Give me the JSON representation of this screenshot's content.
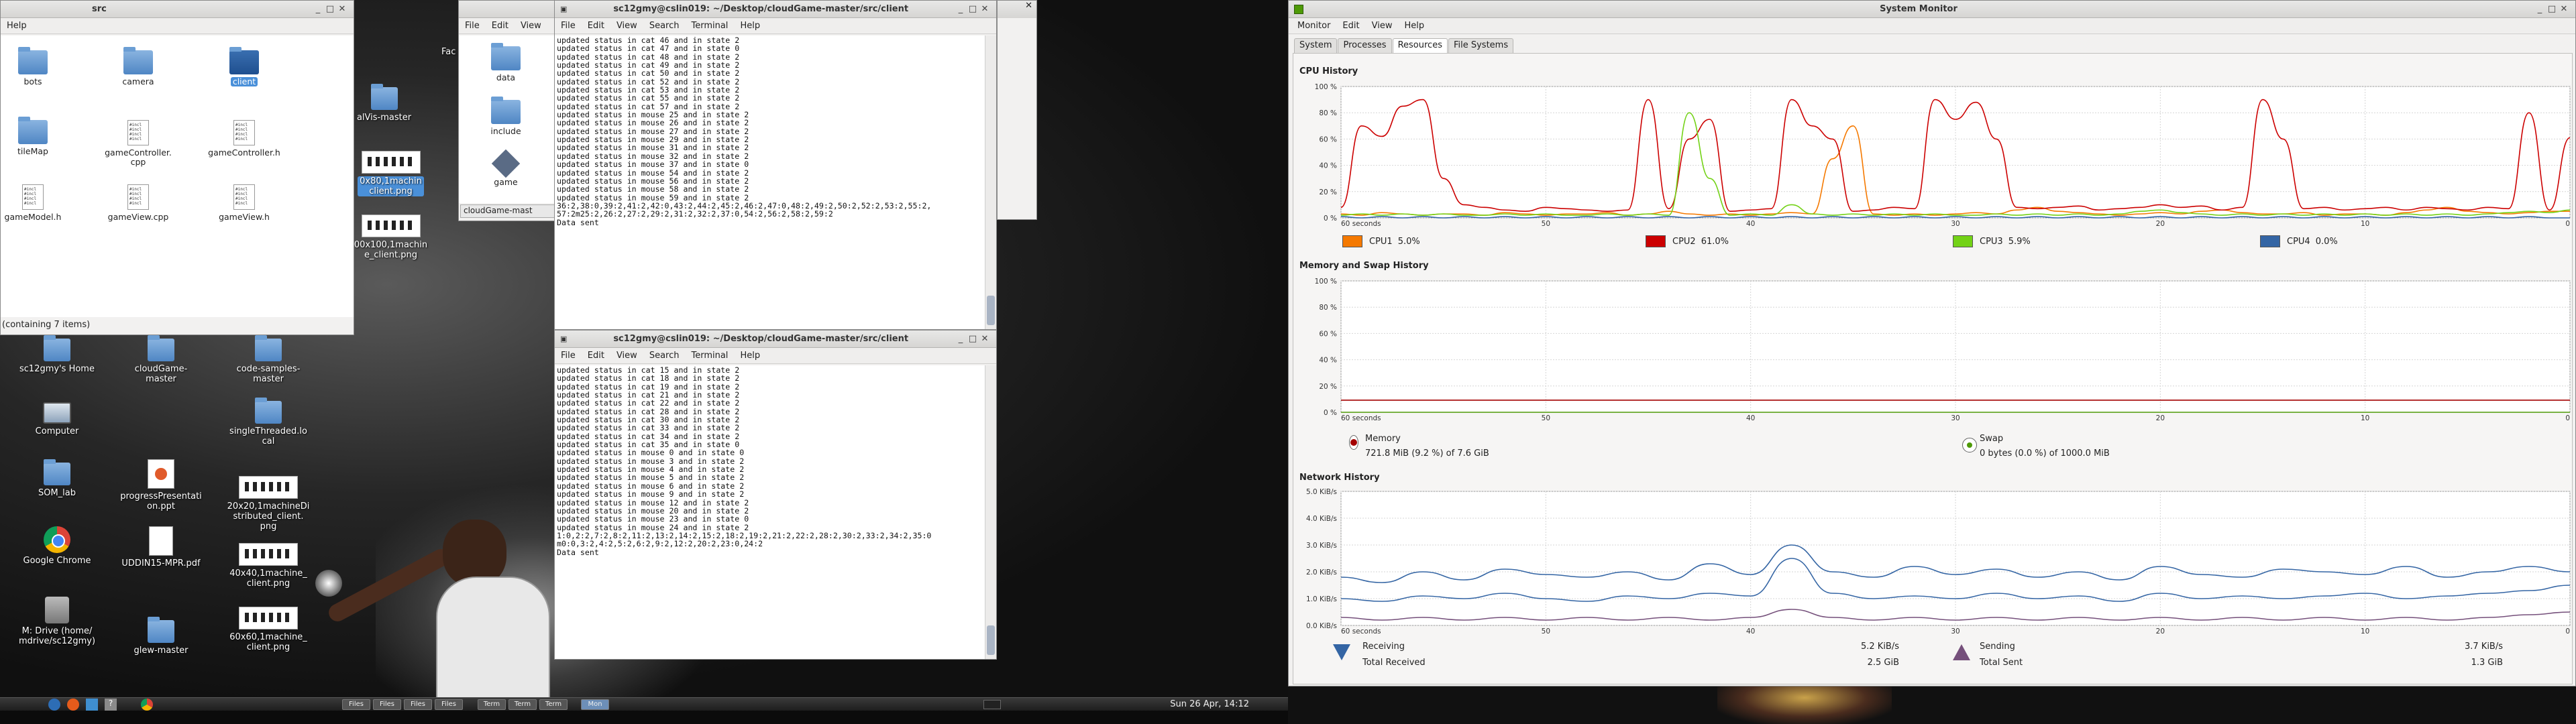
{
  "file_manager": {
    "title": "src",
    "menu_help": "Help",
    "status": "(containing 7 items)",
    "items": [
      {
        "label": "bots",
        "kind": "folder"
      },
      {
        "label": "camera",
        "kind": "folder"
      },
      {
        "label": "client",
        "kind": "folder",
        "selected": true
      },
      {
        "label": "tileMap",
        "kind": "folder"
      },
      {
        "label": "gameController.\ncpp",
        "kind": "file"
      },
      {
        "label": "gameController.h",
        "kind": "file"
      },
      {
        "label": "gameModel.h",
        "kind": "file"
      },
      {
        "label": "gameView.cpp",
        "kind": "file"
      },
      {
        "label": "gameView.h",
        "kind": "file"
      }
    ],
    "file_icon_text": "#incl\n#incl\n#incl\n#incl"
  },
  "file_manager_2": {
    "menu": [
      "File",
      "Edit",
      "View",
      "F"
    ],
    "items": [
      {
        "label": "data"
      },
      {
        "label": "include"
      },
      {
        "label": "game"
      }
    ],
    "path_button": "cloudGame-mast"
  },
  "desktop_partial": {
    "fac_label": "Fac",
    "alvis_label": "alVis-master",
    "img1_label": "0x80,1machin\nclient.png",
    "img2_label": "00x100,1machin\ne_client.png"
  },
  "terminal_top": {
    "title": "sc12gmy@cslin019: ~/Desktop/cloudGame-master/src/client",
    "menu": [
      "File",
      "Edit",
      "View",
      "Search",
      "Terminal",
      "Help"
    ],
    "lines": [
      "updated status in cat 46 and in state 2",
      "updated status in cat 47 and in state 0",
      "updated status in cat 48 and in state 2",
      "updated status in cat 49 and in state 2",
      "updated status in cat 50 and in state 2",
      "updated status in cat 52 and in state 2",
      "updated status in cat 53 and in state 2",
      "updated status in cat 55 and in state 2",
      "updated status in cat 57 and in state 2",
      "updated status in mouse 25 and in state 2",
      "updated status in mouse 26 and in state 2",
      "updated status in mouse 27 and in state 2",
      "updated status in mouse 29 and in state 2",
      "updated status in mouse 31 and in state 2",
      "updated status in mouse 32 and in state 2",
      "updated status in mouse 37 and in state 0",
      "updated status in mouse 54 and in state 2",
      "updated status in mouse 56 and in state 2",
      "updated status in mouse 58 and in state 2",
      "updated status in mouse 59 and in state 2",
      "36:2,38:0,39:2,41:2,42:0,43:2,44:2,45:2,46:2,47:0,48:2,49:2,50:2,52:2,53:2,55:2,",
      "57:2m25:2,26:2,27:2,29:2,31:2,32:2,37:0,54:2,56:2,58:2,59:2",
      "Data sent",
      ""
    ]
  },
  "terminal_bottom": {
    "title": "sc12gmy@cslin019: ~/Desktop/cloudGame-master/src/client",
    "menu": [
      "File",
      "Edit",
      "View",
      "Search",
      "Terminal",
      "Help"
    ],
    "lines": [
      "updated status in cat 15 and in state 2",
      "updated status in cat 18 and in state 2",
      "updated status in cat 19 and in state 2",
      "updated status in cat 21 and in state 2",
      "updated status in cat 22 and in state 2",
      "updated status in cat 28 and in state 2",
      "updated status in cat 30 and in state 2",
      "updated status in cat 33 and in state 2",
      "updated status in cat 34 and in state 2",
      "updated status in cat 35 and in state 0",
      "updated status in mouse 0 and in state 0",
      "updated status in mouse 3 and in state 2",
      "updated status in mouse 4 and in state 2",
      "updated status in mouse 5 and in state 2",
      "updated status in mouse 6 and in state 2",
      "updated status in mouse 9 and in state 2",
      "updated status in mouse 12 and in state 2",
      "updated status in mouse 20 and in state 2",
      "updated status in mouse 23 and in state 0",
      "updated status in mouse 24 and in state 2",
      "1:0,2:2,7:2,8:2,11:2,13:2,14:2,15:2,18:2,19:2,21:2,22:2,28:2,30:2,33:2,34:2,35:0",
      "m0:0,3:2,4:2,5:2,6:2,9:2,12:2,20:2,23:0,24:2",
      "Data sent",
      ""
    ]
  },
  "desktop_icons": [
    {
      "label": "sc12gmy's Home",
      "kind": "folder"
    },
    {
      "label": "cloudGame-\nmaster",
      "kind": "folder"
    },
    {
      "label": "code-samples-\nmaster",
      "kind": "folder"
    },
    {
      "label": "Computer",
      "kind": "computer"
    },
    {
      "label": "singleThreaded.lo\ncal",
      "kind": "folder"
    },
    {
      "label": "SOM_lab",
      "kind": "folder"
    },
    {
      "label": "progressPresentati\non.ppt",
      "kind": "ppt"
    },
    {
      "label": "20x20,1machineDi\nstributed_client.\npng",
      "kind": "image"
    },
    {
      "label": "Google Chrome",
      "kind": "chrome"
    },
    {
      "label": "UDDIN15-MPR.pdf",
      "kind": "doc"
    },
    {
      "label": "40x40,1machine_\nclient.png",
      "kind": "image"
    },
    {
      "label": "M: Drive (home/\nmdrive/sc12gmy)",
      "kind": "drive"
    },
    {
      "label": "glew-master",
      "kind": "folder"
    },
    {
      "label": "60x60,1machine_\nclient.png",
      "kind": "image"
    }
  ],
  "taskbar": {
    "clock": "Sun 26 Apr, 14:12",
    "buttons": [
      "Files",
      "Files",
      "Files",
      "Files",
      "Term",
      "Term",
      "Term",
      "Mon"
    ]
  },
  "system_monitor": {
    "title": "System Monitor",
    "menu": [
      "Monitor",
      "Edit",
      "View",
      "Help"
    ],
    "tabs": [
      "System",
      "Processes",
      "Resources",
      "File Systems"
    ],
    "active_tab": "Resources",
    "cpu_title": "CPU History",
    "mem_title": "Memory and Swap History",
    "net_title": "Network History",
    "cpu_legend": [
      {
        "name": "CPU1",
        "value": "5.0%",
        "color": "#f57900"
      },
      {
        "name": "CPU2",
        "value": "61.0%",
        "color": "#cc0000"
      },
      {
        "name": "CPU3",
        "value": "5.9%",
        "color": "#73d216"
      },
      {
        "name": "CPU4",
        "value": "0.0%",
        "color": "#3465a4"
      }
    ],
    "memory": {
      "label": "Memory",
      "value": "721.8 MiB (9.2 %) of 7.6 GiB",
      "color": "#a40000"
    },
    "swap": {
      "label": "Swap",
      "value": "0 bytes (0.0 %) of 1000.0 MiB",
      "color": "#4e9a06"
    },
    "network": {
      "receiving_label": "Receiving",
      "receiving_value": "5.2 KiB/s",
      "total_received_label": "Total Received",
      "total_received_value": "2.5 GiB",
      "sending_label": "Sending",
      "sending_value": "3.7 KiB/s",
      "total_sent_label": "Total Sent",
      "total_sent_value": "1.3 GiB",
      "receiving_color": "#3465a4",
      "sending_color": "#75507b"
    }
  },
  "chart_data": [
    {
      "type": "line",
      "title": "CPU History",
      "x_tick_labels": [
        "60 seconds",
        "50",
        "40",
        "30",
        "20",
        "10",
        "0"
      ],
      "y_tick_labels": [
        "100 %",
        "80 %",
        "60 %",
        "40 %",
        "20 %",
        "0 %"
      ],
      "ylim": [
        0,
        100
      ],
      "x": [
        60,
        59,
        58,
        57,
        56,
        55,
        54,
        53,
        52,
        51,
        50,
        49,
        48,
        47,
        46,
        45,
        44,
        43,
        42,
        41,
        40,
        39,
        38,
        37,
        36,
        35,
        34,
        33,
        32,
        31,
        30,
        29,
        28,
        27,
        26,
        25,
        24,
        23,
        22,
        21,
        20,
        19,
        18,
        17,
        16,
        15,
        14,
        13,
        12,
        11,
        10,
        9,
        8,
        7,
        6,
        5,
        4,
        3,
        2,
        1,
        0
      ],
      "series": [
        {
          "name": "CPU1",
          "values": [
            3,
            2,
            4,
            3,
            2,
            3,
            3,
            2,
            4,
            3,
            2,
            3,
            3,
            4,
            2,
            3,
            5,
            3,
            2,
            3,
            2,
            3,
            4,
            3,
            45,
            70,
            3,
            2,
            3,
            2,
            3,
            4,
            3,
            6,
            8,
            5,
            4,
            3,
            2,
            3,
            4,
            3,
            5,
            6,
            4,
            3,
            3,
            4,
            2,
            3,
            3,
            2,
            4,
            6,
            8,
            5,
            4,
            3,
            4,
            5,
            5
          ]
        },
        {
          "name": "CPU2",
          "values": [
            8,
            70,
            62,
            85,
            90,
            30,
            10,
            8,
            6,
            5,
            8,
            7,
            6,
            5,
            6,
            90,
            7,
            60,
            75,
            5,
            6,
            7,
            90,
            70,
            60,
            5,
            6,
            8,
            7,
            90,
            75,
            88,
            60,
            8,
            7,
            8,
            9,
            6,
            7,
            8,
            10,
            8,
            9,
            6,
            8,
            90,
            60,
            7,
            8,
            6,
            7,
            8,
            6,
            8,
            7,
            6,
            8,
            7,
            80,
            6,
            61
          ]
        },
        {
          "name": "CPU3",
          "values": [
            2,
            3,
            2,
            3,
            2,
            3,
            2,
            2,
            3,
            2,
            3,
            2,
            2,
            3,
            2,
            3,
            2,
            80,
            30,
            2,
            3,
            2,
            10,
            3,
            2,
            3,
            2,
            3,
            2,
            3,
            2,
            2,
            3,
            2,
            3,
            2,
            3,
            2,
            3,
            5,
            6,
            4,
            3,
            2,
            3,
            2,
            3,
            2,
            3,
            2,
            3,
            2,
            3,
            2,
            3,
            2,
            3,
            4,
            5,
            4,
            6
          ]
        },
        {
          "name": "CPU4",
          "values": [
            1,
            0,
            1,
            0,
            1,
            0,
            1,
            0,
            1,
            0,
            1,
            0,
            1,
            0,
            1,
            0,
            1,
            0,
            1,
            0,
            1,
            0,
            1,
            0,
            1,
            0,
            1,
            0,
            1,
            0,
            1,
            0,
            1,
            0,
            1,
            0,
            1,
            0,
            1,
            0,
            1,
            0,
            1,
            0,
            1,
            0,
            1,
            0,
            1,
            0,
            1,
            0,
            1,
            0,
            1,
            0,
            1,
            0,
            1,
            0,
            0
          ]
        }
      ]
    },
    {
      "type": "line",
      "title": "Memory and Swap History",
      "x_tick_labels": [
        "60 seconds",
        "50",
        "40",
        "30",
        "20",
        "10",
        "0"
      ],
      "y_tick_labels": [
        "100 %",
        "80 %",
        "60 %",
        "40 %",
        "20 %",
        "0 %"
      ],
      "ylim": [
        0,
        100
      ],
      "x": [
        60,
        0
      ],
      "series": [
        {
          "name": "Memory",
          "values": [
            9.2,
            9.2
          ]
        },
        {
          "name": "Swap",
          "values": [
            0,
            0
          ]
        }
      ]
    },
    {
      "type": "line",
      "title": "Network History",
      "x_tick_labels": [
        "60 seconds",
        "50",
        "40",
        "30",
        "20",
        "10",
        "0"
      ],
      "y_tick_labels": [
        "5.0 KiB/s",
        "4.0 KiB/s",
        "3.0 KiB/s",
        "2.0 KiB/s",
        "1.0 KiB/s",
        "0.0 KiB/s"
      ],
      "ylim": [
        0,
        5
      ],
      "x": [
        60,
        58,
        56,
        54,
        52,
        50,
        48,
        46,
        44,
        42,
        40,
        38,
        36,
        34,
        32,
        30,
        28,
        26,
        24,
        22,
        20,
        18,
        16,
        14,
        12,
        10,
        8,
        6,
        4,
        2,
        0
      ],
      "series": [
        {
          "name": "Receiving",
          "values": [
            1.8,
            1.6,
            2.0,
            1.7,
            2.1,
            1.9,
            1.8,
            2.0,
            1.7,
            2.3,
            1.9,
            3.0,
            2.0,
            1.8,
            2.2,
            1.9,
            2.1,
            1.8,
            2.0,
            1.7,
            2.2,
            1.9,
            1.8,
            2.1,
            2.0,
            1.9,
            2.2,
            1.8,
            2.0,
            2.2,
            2.0
          ]
        },
        {
          "name": "Sending",
          "values": [
            1.0,
            0.9,
            1.1,
            1.0,
            1.2,
            1.0,
            0.9,
            1.1,
            1.0,
            1.2,
            1.1,
            2.5,
            1.2,
            1.0,
            1.1,
            1.0,
            1.2,
            1.0,
            1.1,
            0.9,
            1.2,
            1.0,
            1.1,
            1.0,
            1.1,
            1.2,
            1.0,
            1.1,
            1.2,
            1.3,
            1.5
          ]
        },
        {
          "name": "Sending-low",
          "values": [
            0.3,
            0.2,
            0.3,
            0.2,
            0.3,
            0.2,
            0.3,
            0.2,
            0.3,
            0.2,
            0.3,
            0.6,
            0.3,
            0.2,
            0.3,
            0.2,
            0.3,
            0.2,
            0.3,
            0.2,
            0.3,
            0.2,
            0.3,
            0.2,
            0.3,
            0.2,
            0.3,
            0.2,
            0.3,
            0.4,
            0.5
          ]
        }
      ]
    }
  ]
}
